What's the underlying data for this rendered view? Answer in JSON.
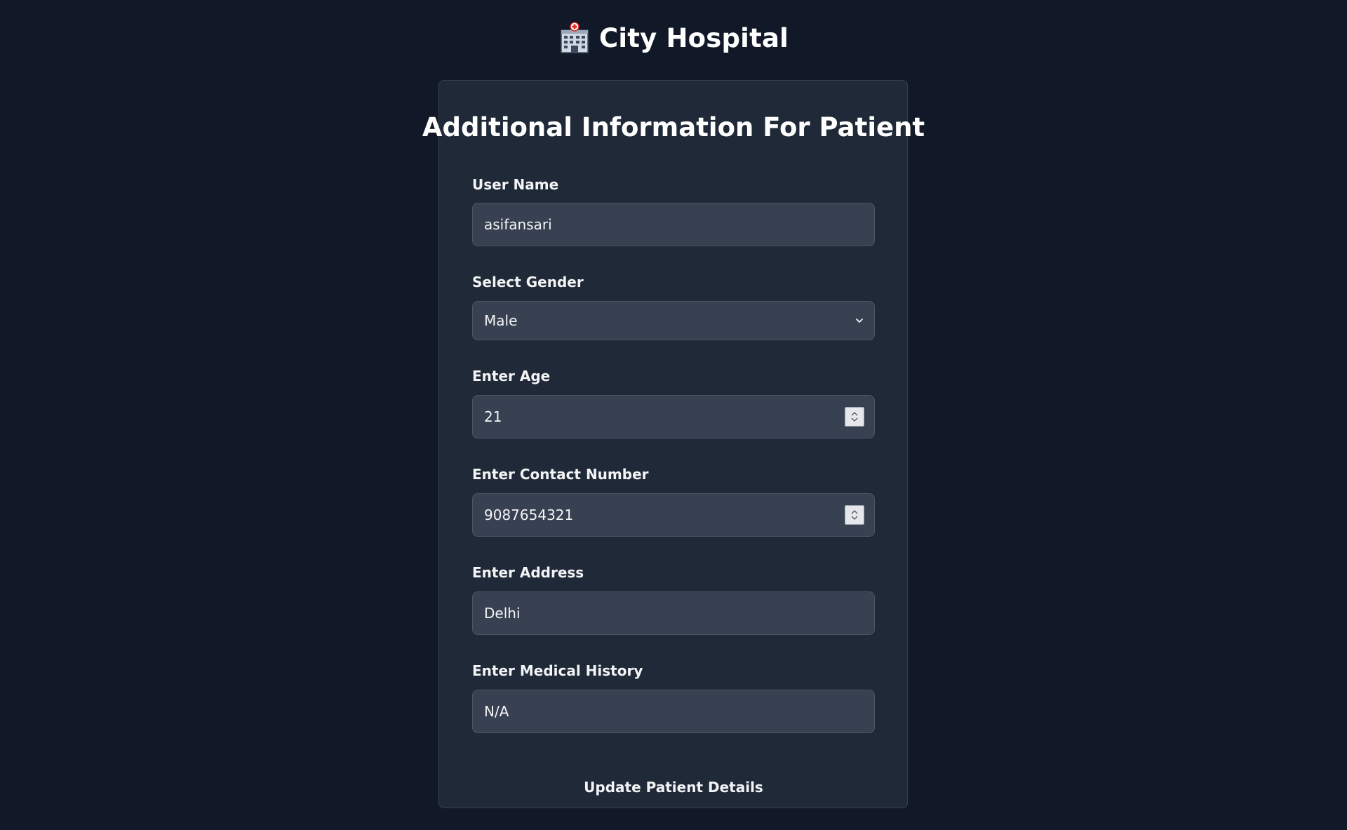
{
  "header": {
    "title": "City Hospital",
    "icon": "hospital-icon"
  },
  "form": {
    "title": "Additional Information For Patient",
    "fields": {
      "user_name": {
        "label": "User Name",
        "value": "asifansari"
      },
      "gender": {
        "label": "Select Gender",
        "value": "Male"
      },
      "age": {
        "label": "Enter Age",
        "value": "21"
      },
      "contact": {
        "label": "Enter Contact Number",
        "value": "9087654321"
      },
      "address": {
        "label": "Enter Address",
        "value": "Delhi"
      },
      "medical_history": {
        "label": "Enter Medical History",
        "value": "N/A"
      }
    },
    "submit_label": "Update Patient Details"
  },
  "colors": {
    "page_background": "#111827",
    "card_background": "#1f2937",
    "input_background": "#374151",
    "text": "#f3f4f6"
  }
}
